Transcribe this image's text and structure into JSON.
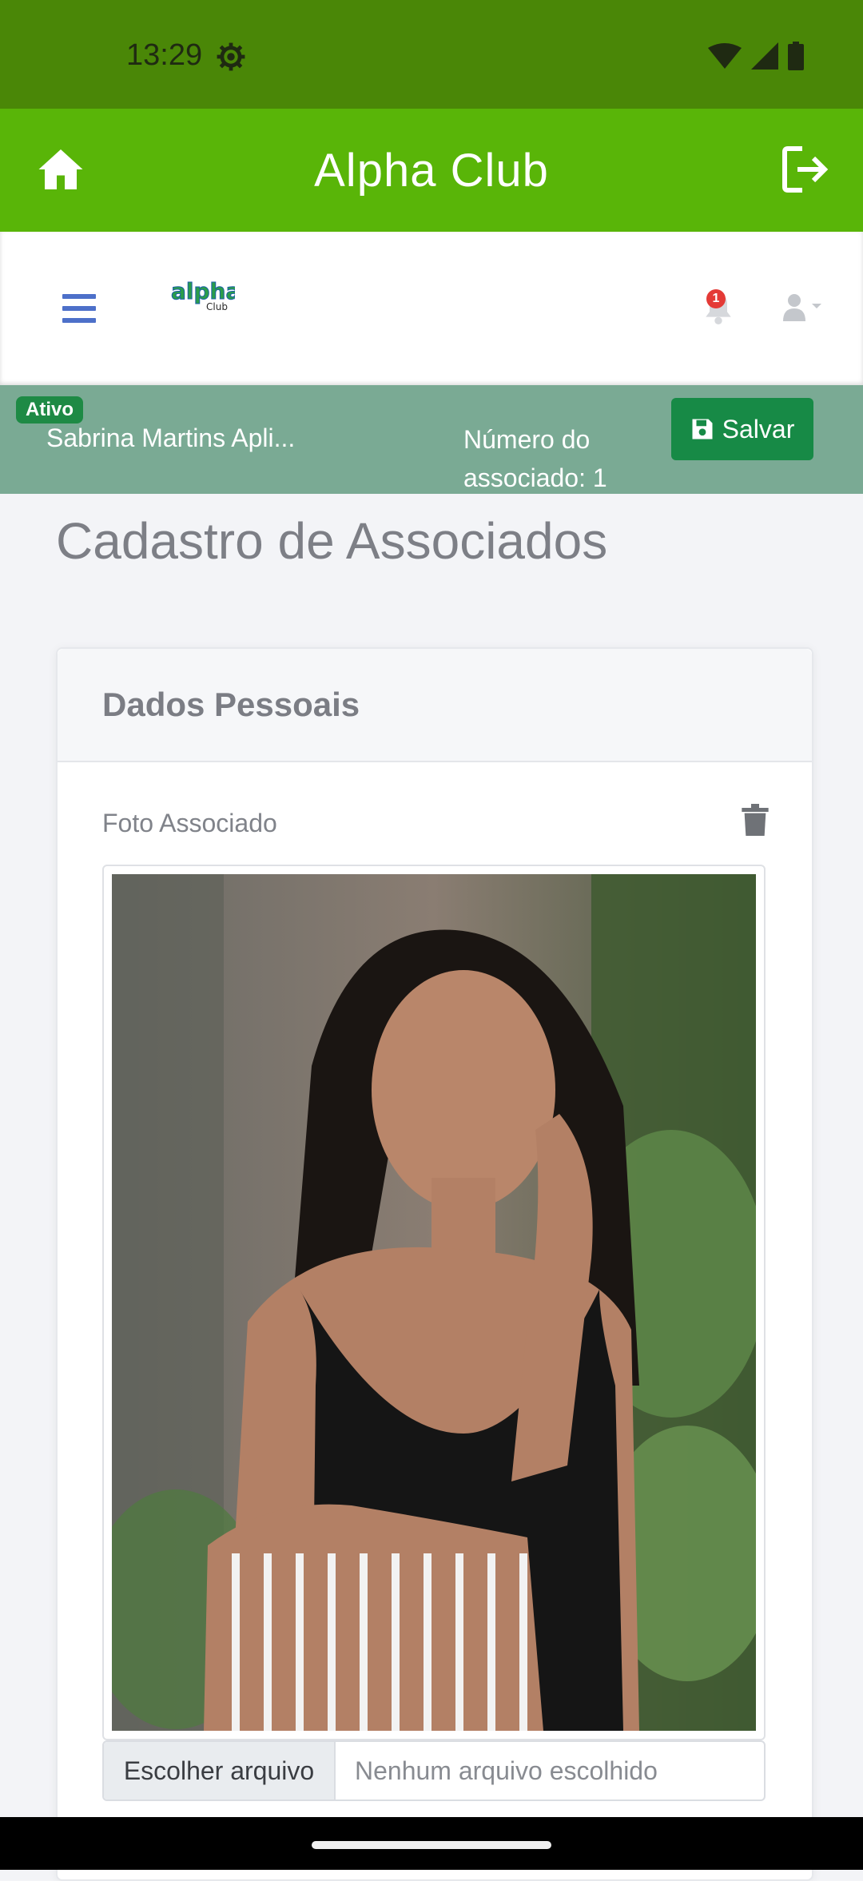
{
  "status_bar": {
    "time": "13:29"
  },
  "app_bar": {
    "title": "Alpha Club"
  },
  "nav": {
    "notification_count": "1",
    "logo_text": "alpha",
    "logo_subtext": "Club"
  },
  "member": {
    "status_badge": "Ativo",
    "name": "Sabrina Martins Apli...",
    "number_label": "Número do associado: 1",
    "save_label": "Salvar"
  },
  "page": {
    "title": "Cadastro de Associados"
  },
  "card": {
    "title": "Dados Pessoais",
    "photo_label": "Foto Associado",
    "file_button_label": "Escolher arquivo",
    "file_status": "Nenhum arquivo escolhido"
  },
  "colors": {
    "status_bar": "#4a8707",
    "app_bar": "#59b508",
    "info_bar": "#7aaa94",
    "save_button": "#178a46",
    "badge_red": "#e43a36"
  }
}
